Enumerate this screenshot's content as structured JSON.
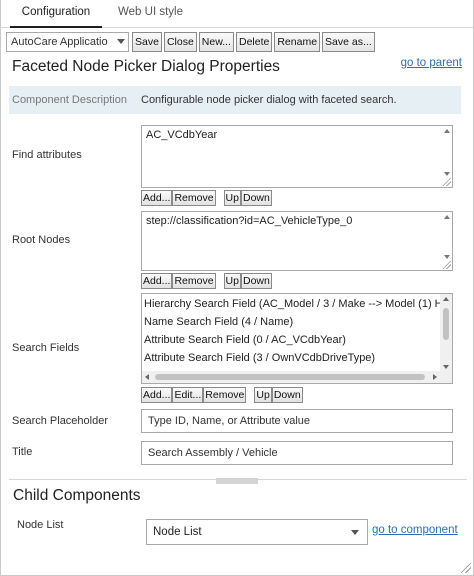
{
  "tabs": [
    {
      "label": "Configuration"
    },
    {
      "label": "Web UI style"
    }
  ],
  "toolbar": {
    "app_select": "AutoCare Applicatio",
    "buttons": [
      "Save",
      "Close",
      "New...",
      "Delete",
      "Rename",
      "Save as..."
    ]
  },
  "page": {
    "title": "Faceted Node Picker Dialog Properties",
    "go_to_parent": "go to parent"
  },
  "component_description": {
    "label": "Component Description",
    "value": "Configurable node picker dialog with faceted search."
  },
  "find_attributes": {
    "label": "Find attributes",
    "value": "AC_VCdbYear",
    "buttons": [
      "Add...",
      "Remove",
      "Up",
      "Down"
    ]
  },
  "root_nodes": {
    "label": "Root Nodes",
    "value": "step://classification?id=AC_VehicleType_0",
    "buttons": [
      "Add...",
      "Remove",
      "Up",
      "Down"
    ]
  },
  "search_fields": {
    "label": "Search Fields",
    "items": [
      "Hierarchy Search Field (AC_Model / 3 / Make --> Model (1) H",
      "Name Search Field (4 / Name)",
      "Attribute Search Field (0 / AC_VCdbYear)",
      "Attribute Search Field (3 / OwnVCdbDriveType)"
    ],
    "buttons": [
      "Add...",
      "Edit...",
      "Remove",
      "Up",
      "Down"
    ]
  },
  "search_placeholder": {
    "label": "Search Placeholder",
    "value": "Type ID, Name, or Attribute value"
  },
  "title_field": {
    "label": "Title",
    "value": "Search Assembly / Vehicle"
  },
  "child_components": {
    "heading": "Child Components",
    "node_list_label": "Node List",
    "node_list_value": "Node List",
    "go_to_component": "go to component"
  }
}
